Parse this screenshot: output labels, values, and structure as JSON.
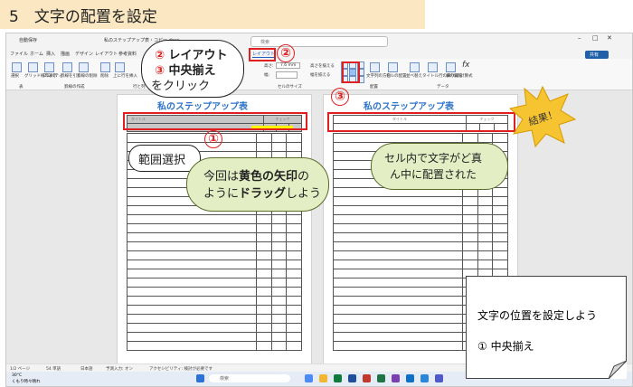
{
  "banner": {
    "title": "5　文字の配置を設定"
  },
  "titlebar": {
    "autosave": "自動保存",
    "doc_name": "私のステップアップ表・コピー.docx",
    "search_placeholder": "検索",
    "share": "共有"
  },
  "menu": [
    "ファイル",
    "ホーム",
    "挿入",
    "描画",
    "デザイン",
    "レイアウト",
    "参考資料",
    "差し込み文書",
    "校閲",
    "表示",
    "ヘルプ",
    "テーブルデザイン",
    "レイアウト"
  ],
  "ribbon": {
    "select": "選択",
    "gridlines": "グリッド線の表示",
    "properties": "プロパティ",
    "draw_table": "罫線を引く",
    "eraser": "罫線の削除",
    "delete": "削除",
    "insert_above": "上に行を挿入",
    "insert_below": "下に行を挿入",
    "height_label": "高さ:",
    "height_value": "7.6 mm",
    "width_label": "幅:",
    "distribute_rows": "高さを揃える",
    "distribute_cols": "幅を揃える",
    "text_direction": "文字列の方向",
    "cell_margins": "セルの配置",
    "sort": "並べ替え",
    "repeat_header": "タイトル行の繰り返し",
    "convert_text": "表の解除",
    "formula": "計算式",
    "group_table": "表",
    "group_draw": "罫線の作成",
    "group_rows": "行と列",
    "group_cell_size": "セルのサイズ",
    "group_align": "配置",
    "group_data": "データ"
  },
  "pages": {
    "left_title": "私のステップアップ表",
    "right_title": "私のステップアップ表",
    "header_cell": "タイトル",
    "check_header": "チェック"
  },
  "statusbar": {
    "page": "1/2 ページ",
    "chars": "54 単語",
    "lang": "日本語",
    "input": "予測入力: オン",
    "accessibility": "アクセシビリティ: 検討が必要です",
    "zoom": "54%"
  },
  "taskbar": {
    "weather_temp": "30°C",
    "weather_text": "くもり時々晴れ",
    "search": "検索"
  },
  "callouts": {
    "step2_num": "②",
    "step2_label": "レイアウト",
    "step3_num": "③",
    "step3_label": "中央揃え",
    "click_text": "をクリック",
    "red2": "②",
    "red3": "③",
    "red1": "①",
    "range_select": "範囲選択",
    "drag_line1_a": "今回は",
    "drag_line1_b": "黄色の矢印",
    "drag_line1_c": "の",
    "drag_line2_a": "ように",
    "drag_line2_b": "ドラッグ",
    "drag_line2_c": "しよう",
    "result": "結果！",
    "centered_line1": "セル内で文字がど真",
    "centered_line2": "ん中に配置された"
  },
  "note": {
    "heading": "文字の位置を設定しよう",
    "item": "①  中央揃え"
  }
}
